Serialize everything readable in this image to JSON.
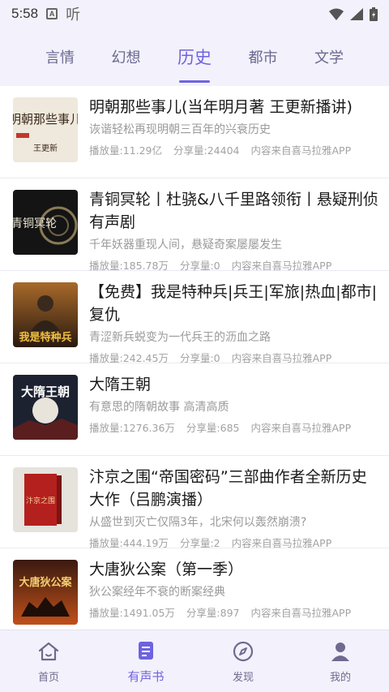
{
  "status": {
    "time": "5:58",
    "badge": "A",
    "app_glyph": "听"
  },
  "tabs": [
    "言情",
    "幻想",
    "历史",
    "都市",
    "文学"
  ],
  "active_tab": 2,
  "items": [
    {
      "title": "明朝那些事儿(当年明月著 王更新播讲)",
      "desc": "诙谐轻松再现明朝三百年的兴衰历史",
      "plays": "播放量:11.29亿",
      "shares": "分享量:24404",
      "source": "内容来自喜马拉雅APP",
      "cover_text": "明朝那些事儿",
      "cover_sub": "王更新"
    },
    {
      "title": "青铜冥轮丨杜骁&八千里路领衔丨悬疑刑侦有声剧",
      "desc": "千年妖器重现人间，悬疑奇案屡屡发生",
      "plays": "播放量:185.78万",
      "shares": "分享量:0",
      "source": "内容来自喜马拉雅APP",
      "cover_text": "青铜冥轮"
    },
    {
      "title": "【免费】我是特种兵|兵王|军旅|热血|都市|复仇",
      "desc": "青涩新兵蜕变为一代兵王的沥血之路",
      "plays": "播放量:242.45万",
      "shares": "分享量:0",
      "source": "内容来自喜马拉雅APP",
      "cover_text": "我是特种兵"
    },
    {
      "title": "大隋王朝",
      "desc": "有意思的隋朝故事 高清高质",
      "plays": "播放量:1276.36万",
      "shares": "分享量:685",
      "source": "内容来自喜马拉雅APP",
      "cover_text": "大隋王朝"
    },
    {
      "title": "汴京之围“帝国密码”三部曲作者全新历史大作（吕鹏演播）",
      "desc": "从盛世到灭亡仅隔3年，北宋何以轰然崩溃?",
      "plays": "播放量:444.19万",
      "shares": "分享量:2",
      "source": "内容来自喜马拉雅APP",
      "cover_text": "汴京之围"
    },
    {
      "title": "大唐狄公案（第一季）",
      "desc": "狄公案经年不衰的断案经典",
      "plays": "播放量:1491.05万",
      "shares": "分享量:897",
      "source": "内容来自喜马拉雅APP",
      "cover_text": "大唐狄公案"
    }
  ],
  "nav": [
    {
      "label": "首页",
      "icon": "home-icon"
    },
    {
      "label": "有声书",
      "icon": "audiobook-icon"
    },
    {
      "label": "发现",
      "icon": "compass-icon"
    },
    {
      "label": "我的",
      "icon": "profile-icon"
    }
  ],
  "active_nav": 1,
  "colors": {
    "accent": "#6e63e0",
    "bar_bg": "#f3f1fb",
    "nav_inactive": "#6f6a8f"
  }
}
